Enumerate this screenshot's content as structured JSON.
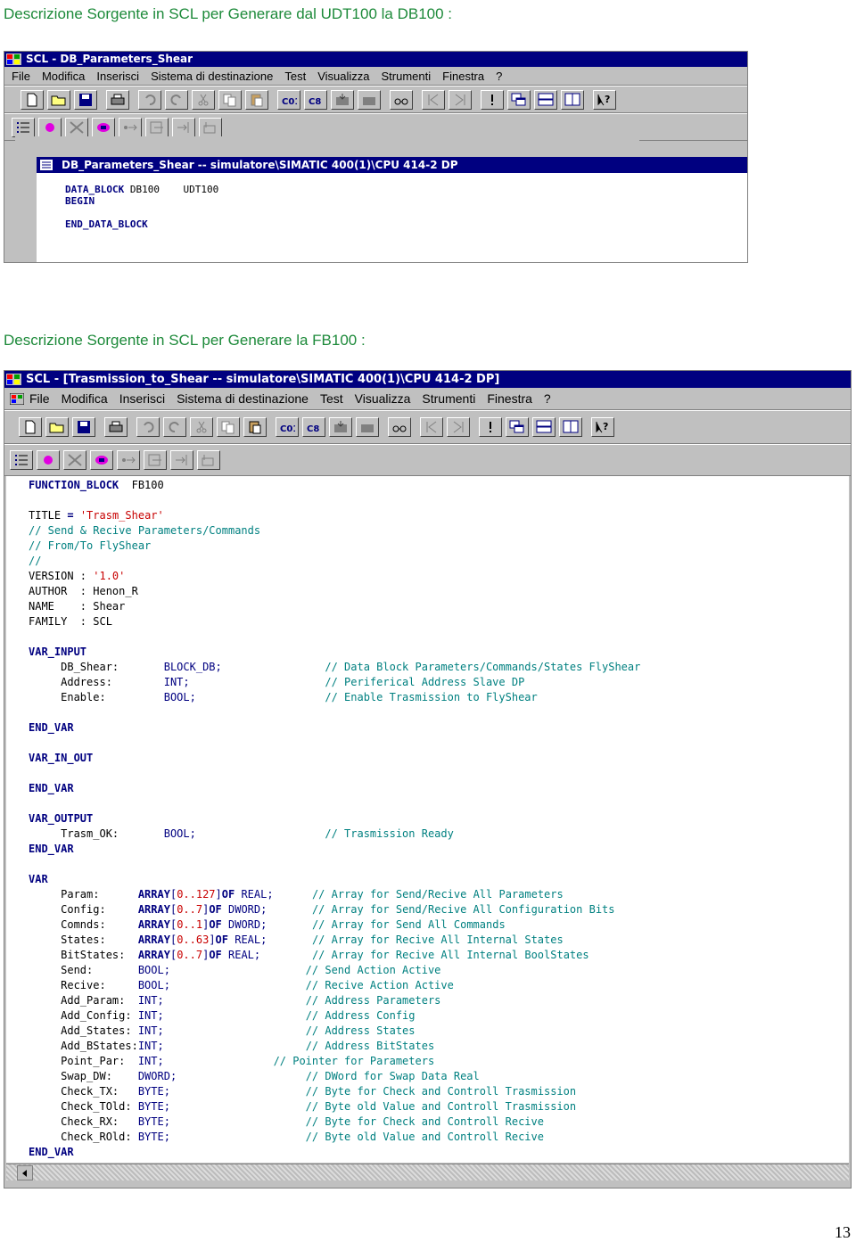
{
  "section1": {
    "heading": "Descrizione Sorgente in SCL per Generare dal UDT100 la DB100 :",
    "window_title": "SCL  - DB_Parameters_Shear",
    "doc_title": "DB_Parameters_Shear -- simulatore\\SIMATIC 400(1)\\CPU 414-2 DP",
    "code": {
      "line1_kw": "DATA_BLOCK",
      "line1_rest": " DB100    UDT100",
      "line2": "BEGIN",
      "line3": "END_DATA_BLOCK"
    }
  },
  "section2": {
    "heading": "Descrizione Sorgente in SCL per Generare la FB100 :",
    "window_title": "SCL  - [Trasmission_to_Shear -- simulatore\\SIMATIC 400(1)\\CPU 414-2 DP]"
  },
  "menu": {
    "items": [
      "File",
      "Modifica",
      "Inserisci",
      "Sistema di destinazione",
      "Test",
      "Visualizza",
      "Strumenti",
      "Finestra",
      "?"
    ]
  },
  "colors": {
    "title_bar": "#000080",
    "heading": "#1d8a3a",
    "keyword": "#000080",
    "comment": "#008080",
    "string": "#c80000"
  },
  "page_number": "13"
}
